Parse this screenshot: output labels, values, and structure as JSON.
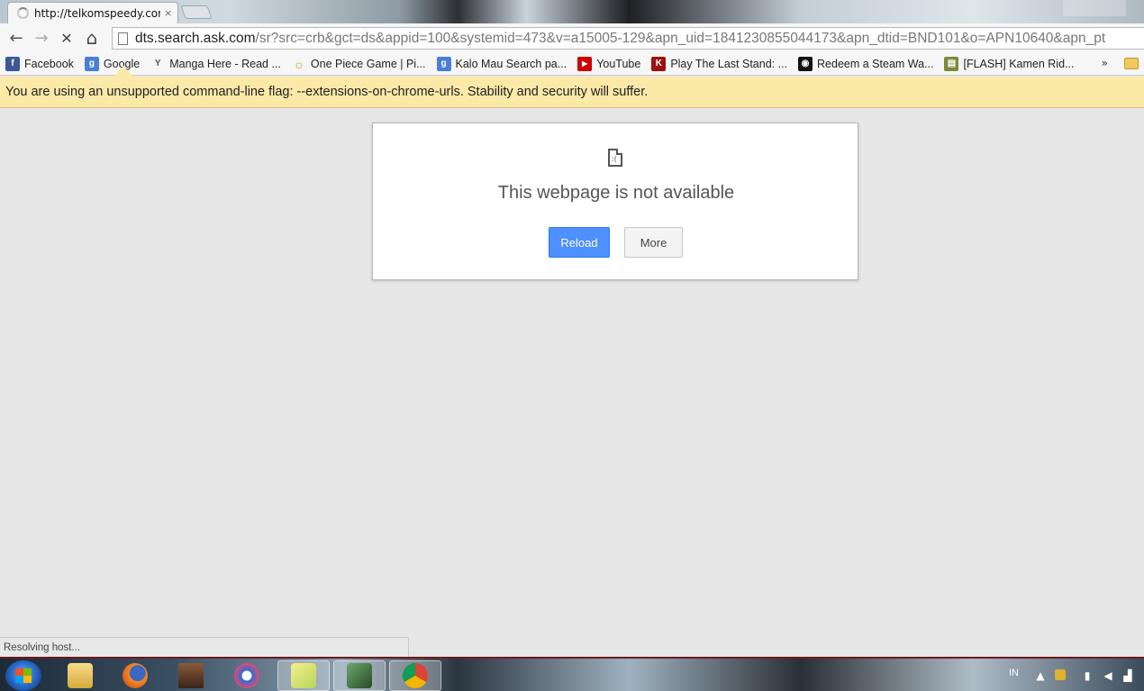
{
  "tab": {
    "title": "http://telkomspeedy.com",
    "close": "×"
  },
  "omnibox": {
    "url_host": "dts.search.ask.com",
    "url_rest": "/sr?src=crb&gct=ds&appid=100&systemid=473&v=a15005-129&apn_uid=1841230855044173&apn_dtid=BND101&o=APN10640&apn_pt"
  },
  "nav": {
    "back": "←",
    "forward": "→",
    "stop": "✕",
    "home": "⌂"
  },
  "bookmarks": [
    {
      "label": "Facebook",
      "icon": "facebook-icon",
      "color": "#3b5998",
      "glyph": "f"
    },
    {
      "label": "Google",
      "icon": "google-icon",
      "color": "#4a7fd8",
      "glyph": "g"
    },
    {
      "label": "Manga Here - Read ...",
      "icon": "mangahere-icon",
      "color": "#ffffff",
      "glyph": "Y"
    },
    {
      "label": "One Piece Game | Pi...",
      "icon": "onepiece-icon",
      "color": "#c89a2a",
      "glyph": "☼"
    },
    {
      "label": "Kalo Mau Search pa...",
      "icon": "google-icon",
      "color": "#4a7fd8",
      "glyph": "g"
    },
    {
      "label": "YouTube",
      "icon": "youtube-icon",
      "color": "#cc0000",
      "glyph": "▶"
    },
    {
      "label": "Play The Last Stand: ...",
      "icon": "kongregate-icon",
      "color": "#9b1111",
      "glyph": "K"
    },
    {
      "label": "Redeem a Steam Wa...",
      "icon": "steam-icon",
      "color": "#111111",
      "glyph": "◉"
    },
    {
      "label": "[FLASH] Kamen Rid...",
      "icon": "flash-game-icon",
      "color": "#7c8a3a",
      "glyph": "▤"
    }
  ],
  "bookmarks_more": "»",
  "infobar": {
    "message": "You are using an unsupported command-line flag: --extensions-on-chrome-urls. Stability and security will suffer."
  },
  "error": {
    "title": "This webpage is not available",
    "reload_label": "Reload",
    "more_label": "More"
  },
  "status": {
    "text": "Resolving host..."
  },
  "taskbar": {
    "language": "IN",
    "apps": [
      {
        "name": "windows-explorer",
        "color": "#e8c35a"
      },
      {
        "name": "firefox",
        "color": "#e66a1f"
      },
      {
        "name": "game-app",
        "color": "#6b4a2a"
      },
      {
        "name": "browser-app",
        "color": "#2a6fcf"
      },
      {
        "name": "file-app",
        "color": "#c7d86a"
      },
      {
        "name": "tool-app",
        "color": "#5a8a5a"
      },
      {
        "name": "chrome",
        "color": "#db4437"
      }
    ]
  }
}
